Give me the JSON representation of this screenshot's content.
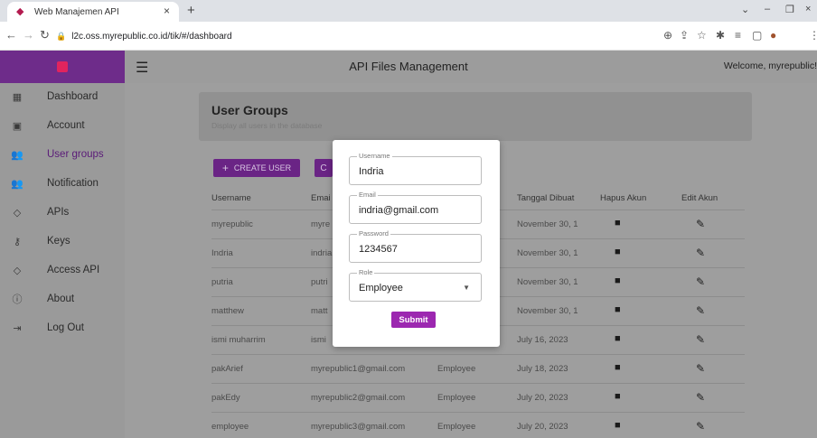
{
  "browser": {
    "tab_title": "Web Manajemen API",
    "tab_close": "×",
    "new_tab": "+",
    "url": "l2c.oss.myrepublic.co.id/tik/#/dashboard"
  },
  "app": {
    "title": "API Files Management",
    "welcome": "Welcome, myrepublic!",
    "accent_color": "#9c27b0"
  },
  "sidebar": {
    "items": [
      {
        "label": "Dashboard",
        "icon": "dashboard-icon"
      },
      {
        "label": "Account",
        "icon": "account-box-icon"
      },
      {
        "label": "User groups",
        "icon": "group-icon",
        "active": true
      },
      {
        "label": "Notification",
        "icon": "notification-group-icon"
      },
      {
        "label": "APIs",
        "icon": "api-icon"
      },
      {
        "label": "Keys",
        "icon": "key-icon"
      },
      {
        "label": "Access API",
        "icon": "api-access-icon"
      },
      {
        "label": "About",
        "icon": "info-icon"
      },
      {
        "label": "Log Out",
        "icon": "logout-icon"
      }
    ]
  },
  "main": {
    "title": "User Groups",
    "subtitle": "Display all users in the database",
    "create_button": "CREATE USER",
    "columns": [
      "Username",
      "Emai",
      "Tanggal Dibuat",
      "Hapus Akun",
      "Edit Akun"
    ],
    "rows": [
      {
        "username": "myrepublic",
        "email": "myre",
        "role": "",
        "date": "November 30, 1"
      },
      {
        "username": "Indria",
        "email": "indria",
        "role": "",
        "date": "November 30, 1"
      },
      {
        "username": "putria",
        "email": "putri",
        "role": "",
        "date": "November 30, 1"
      },
      {
        "username": "matthew",
        "email": "matt",
        "role": "",
        "date": "November 30, 1"
      },
      {
        "username": "ismi muharrim",
        "email": "ismi",
        "role": "",
        "date": "July 16, 2023"
      },
      {
        "username": "pakArief",
        "email": "myrepublic1@gmail.com",
        "role": "Employee",
        "date": "July 18, 2023"
      },
      {
        "username": "pakEdy",
        "email": "myrepublic2@gmail.com",
        "role": "Employee",
        "date": "July 20, 2023"
      },
      {
        "username": "employee",
        "email": "myrepublic3@gmail.com",
        "role": "Employee",
        "date": "July 20, 2023"
      }
    ]
  },
  "modal": {
    "username_label": "Username",
    "username_value": "Indria",
    "email_label": "Email",
    "email_value": "indria@gmail.com",
    "password_label": "Password",
    "password_value": "1234567",
    "role_label": "Role",
    "role_value": "Employee",
    "submit_label": "Submit"
  }
}
